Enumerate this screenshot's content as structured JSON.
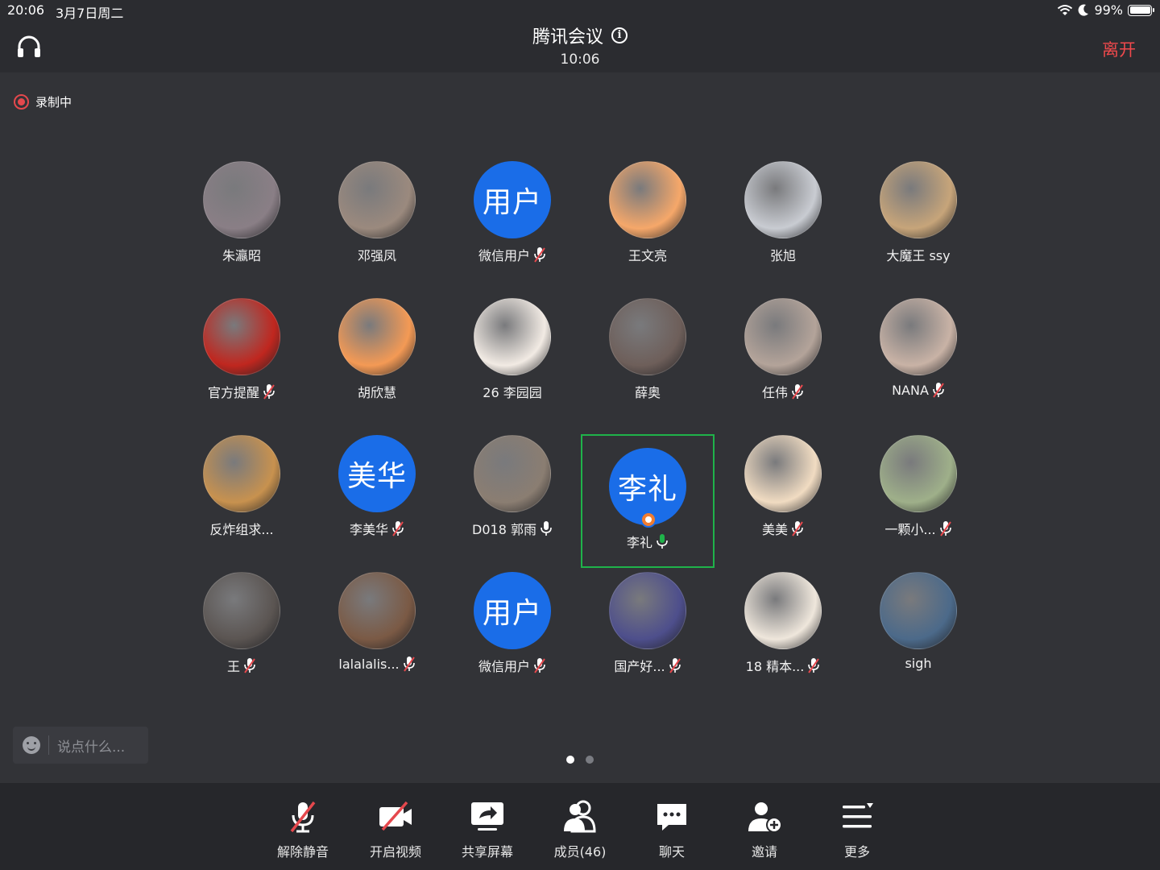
{
  "status_bar": {
    "time": "20:06",
    "date": "3月7日周二",
    "battery": "99%"
  },
  "header": {
    "title": "腾讯会议",
    "duration": "10:06",
    "leave_label": "离开"
  },
  "recording": {
    "label": "录制中"
  },
  "participants": [
    {
      "name": "朱瀛昭",
      "mic": "none",
      "avatar": "photo",
      "color": "#8a7f86"
    },
    {
      "name": "邓强凤",
      "mic": "none",
      "avatar": "photo",
      "color": "#9b8a7e"
    },
    {
      "name": "微信用户",
      "mic": "muted",
      "avatar": "initials",
      "initials": "用户",
      "color": "#1a6de8"
    },
    {
      "name": "王文亮",
      "mic": "none",
      "avatar": "photo",
      "color": "#f6a86a"
    },
    {
      "name": "张旭",
      "mic": "none",
      "avatar": "photo",
      "color": "#c9ccd2"
    },
    {
      "name": "大魔王 ssy",
      "mic": "none",
      "avatar": "photo",
      "color": "#c7a57a"
    },
    {
      "name": "官方提醒",
      "mic": "muted",
      "avatar": "photo",
      "color": "#c0271f"
    },
    {
      "name": "胡欣慧",
      "mic": "none",
      "avatar": "photo",
      "color": "#f49a55"
    },
    {
      "name": "26 李园园",
      "mic": "none",
      "avatar": "photo",
      "color": "#f2ebe4"
    },
    {
      "name": "薛奥",
      "mic": "none",
      "avatar": "photo",
      "color": "#6e5f5a"
    },
    {
      "name": "任伟",
      "mic": "muted",
      "avatar": "photo",
      "color": "#b4a49a"
    },
    {
      "name": "NANA",
      "mic": "muted",
      "avatar": "photo",
      "color": "#c9b3a6"
    },
    {
      "name": "反炸组求...",
      "mic": "none",
      "avatar": "photo",
      "color": "#c8924f"
    },
    {
      "name": "李美华",
      "mic": "muted",
      "avatar": "initials",
      "initials": "美华",
      "color": "#1a6de8"
    },
    {
      "name": "D018 郭雨",
      "mic": "off",
      "avatar": "photo",
      "color": "#8b7e72"
    },
    {
      "name": "李礼",
      "mic": "on",
      "avatar": "initials",
      "initials": "李礼",
      "color": "#1a6de8",
      "active": true,
      "host": true
    },
    {
      "name": "美美",
      "mic": "muted",
      "avatar": "photo",
      "color": "#f1dcc2"
    },
    {
      "name": "一颗小...",
      "mic": "muted",
      "avatar": "photo",
      "color": "#9fb08a"
    },
    {
      "name": "王",
      "mic": "muted",
      "avatar": "photo",
      "color": "#5b5552"
    },
    {
      "name": "lalalalis...",
      "mic": "muted",
      "avatar": "photo",
      "color": "#7b5a45"
    },
    {
      "name": "微信用户",
      "mic": "muted",
      "avatar": "initials",
      "initials": "用户",
      "color": "#1a6de8"
    },
    {
      "name": "国产好...",
      "mic": "muted",
      "avatar": "photo",
      "color": "#4e4f8c"
    },
    {
      "name": "18 精本...",
      "mic": "muted",
      "avatar": "photo",
      "color": "#efe7dc"
    },
    {
      "name": "sigh",
      "mic": "none",
      "avatar": "photo",
      "color": "#4c6a8a"
    }
  ],
  "chat": {
    "placeholder": "说点什么..."
  },
  "pager": {
    "pages": 2,
    "current": 1
  },
  "toolbar": {
    "unmute": "解除静音",
    "video": "开启视频",
    "share": "共享屏幕",
    "members": "成员(46)",
    "chat": "聊天",
    "invite": "邀请",
    "more": "更多"
  },
  "colors": {
    "accent": "#1a6de8",
    "leave": "#f0494c",
    "active_border": "#1fb34a",
    "mic_on": "#1fb34a",
    "mute_slash": "#e5484d"
  }
}
